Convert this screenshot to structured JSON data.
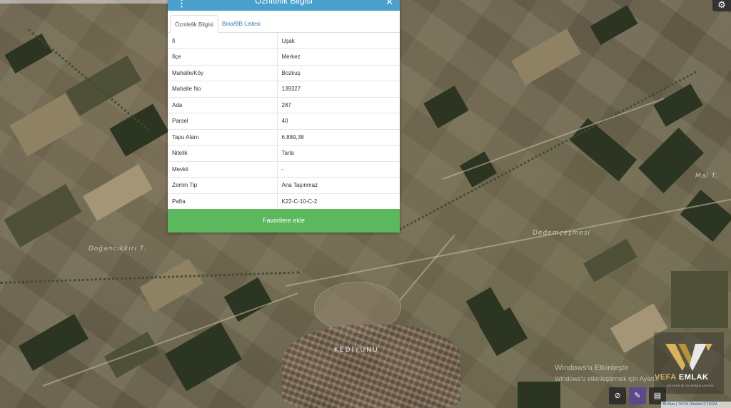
{
  "panel": {
    "title": "Öznitelik Bilgisi",
    "close_icon": "close-icon",
    "menu_icon": "vertical-dots-icon",
    "tabs": [
      {
        "label": "Öznitelik Bilgisi",
        "active": true
      },
      {
        "label": "Bina/BB Listesi",
        "active": false
      }
    ],
    "rows": [
      {
        "key": "İl",
        "value": "Uşak"
      },
      {
        "key": "İlçe",
        "value": "Merkez"
      },
      {
        "key": "Mahalle/Köy",
        "value": "Bozkuş"
      },
      {
        "key": "Mahalle No",
        "value": "139327"
      },
      {
        "key": "Ada",
        "value": "287"
      },
      {
        "key": "Parsel",
        "value": "40"
      },
      {
        "key": "Tapu Alanı",
        "value": "6.889,38"
      },
      {
        "key": "Nitelik",
        "value": "Tarla"
      },
      {
        "key": "Mevkii",
        "value": "-"
      },
      {
        "key": "Zemin Tip",
        "value": "Ana Taşınmaz"
      },
      {
        "key": "Pafta",
        "value": "K22-C-10-C-2"
      }
    ],
    "favorite_button": "Favorilere ekle",
    "header_color": "#4aa0cc",
    "button_color": "#5cb85c"
  },
  "map": {
    "labels": {
      "doganci": "Doğancıkkırı T.",
      "dedem": "Dedemçeşmesi",
      "mal": "Mal T.",
      "village": "KEDİYUNU"
    },
    "settings_icon": "gear-icon"
  },
  "watermark": {
    "win_title": "Windows'u Etkinleştir",
    "win_sub": "Windows'u etkinleştirmek için Ayarlar",
    "brand_a": "VEFA",
    "brand_b": "EMLAK",
    "slogan": "GÜVENİLİR YATIRIMIN ADRESİ"
  },
  "toolbar": {
    "items": [
      "eye-off-icon",
      "pen-icon",
      "map-icon"
    ]
  },
  "attribution": {
    "prefix": "Bi Atlas | TKGM Ortofoto",
    "suffix": "© TKGM"
  }
}
